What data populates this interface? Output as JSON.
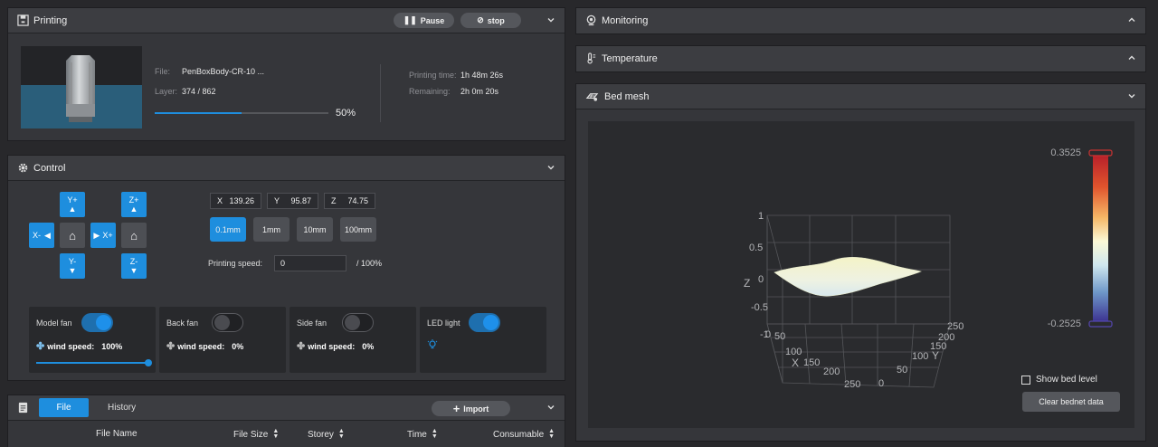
{
  "printing": {
    "title": "Printing",
    "pause_label": "Pause",
    "stop_label": "stop",
    "file_label": "File:",
    "file_value": "PenBoxBody-CR-10 ...",
    "layer_label": "Layer:",
    "layer_value": "374 / 862",
    "progress_percent": 50,
    "progress_text": "50%",
    "printing_time_label": "Printing time:",
    "printing_time_value": "1h 48m 26s",
    "remaining_label": "Remaining:",
    "remaining_value": "2h 0m 20s"
  },
  "control": {
    "title": "Control",
    "jog": {
      "y_plus": "Y+",
      "y_minus": "Y-",
      "x_minus": "X-",
      "x_plus": "X+",
      "z_plus": "Z+",
      "z_minus": "Z-"
    },
    "coords": [
      {
        "axis": "X",
        "value": "139.26"
      },
      {
        "axis": "Y",
        "value": "95.87"
      },
      {
        "axis": "Z",
        "value": "74.75"
      }
    ],
    "steps": [
      "0.1mm",
      "1mm",
      "10mm",
      "100mm"
    ],
    "active_step": "0.1mm",
    "speed_label": "Printing speed:",
    "speed_value": "0",
    "speed_suffix": "/ 100%",
    "fans": [
      {
        "name": "Model fan",
        "on": true,
        "speed_label": "wind speed:",
        "speed": "100%",
        "slider_fraction": 1.0
      },
      {
        "name": "Back fan",
        "on": false,
        "speed_label": "wind speed:",
        "speed": "0%"
      },
      {
        "name": "Side fan",
        "on": false,
        "speed_label": "wind speed:",
        "speed": "0%"
      },
      {
        "name": "LED light",
        "on": true
      }
    ]
  },
  "files": {
    "tab_file": "File",
    "tab_history": "History",
    "import_label": "Import",
    "columns": [
      "File Name",
      "File Size",
      "Storey",
      "Time",
      "Consumable"
    ]
  },
  "right": {
    "monitoring_title": "Monitoring",
    "temperature_title": "Temperature",
    "bed_mesh_title": "Bed mesh",
    "show_bed_level_label": "Show bed level",
    "clear_label": "Clear bednet data",
    "colorbar_max": "0.3525",
    "colorbar_min": "-0.2525",
    "axis_z_label": "Z",
    "axis_x_label": "X",
    "axis_y_label": "Y",
    "z_ticks": [
      "1",
      "0.5",
      "0",
      "-0.5",
      "-1"
    ],
    "x_ticks": [
      "50",
      "100",
      "150",
      "200",
      "250"
    ],
    "y_ticks": [
      "250",
      "200",
      "150",
      "100",
      "50",
      "0"
    ],
    "x_zero": "0"
  },
  "colors": {
    "accent": "#1e8ede",
    "panel": "#35363a",
    "background": "#28282b"
  }
}
